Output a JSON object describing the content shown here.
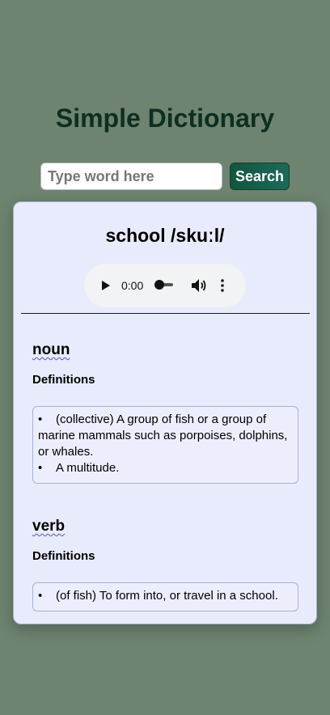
{
  "app_title": "Simple Dictionary",
  "search": {
    "placeholder": "Type word here",
    "button_label": "Search"
  },
  "entry": {
    "heading": "school /skuːl/",
    "audio": {
      "time": "0:00",
      "play_icon": "play-icon",
      "volume_icon": "volume-icon",
      "more_icon": "more-vertical-icon"
    },
    "meanings": [
      {
        "part_of_speech": "noun",
        "definitions_label": "Definitions",
        "definitions": [
          "(collective) A group of fish or a group of marine mammals such as porpoises, dolphins, or whales.",
          "A multitude."
        ]
      },
      {
        "part_of_speech": "verb",
        "definitions_label": "Definitions",
        "definitions": [
          "(of fish) To form into, or travel in a school."
        ]
      }
    ]
  },
  "colors": {
    "background": "#6e8370",
    "title": "#0d2f21",
    "button": "#13553f",
    "card": "#e8ebfb",
    "underline": "#5a4fc9"
  }
}
